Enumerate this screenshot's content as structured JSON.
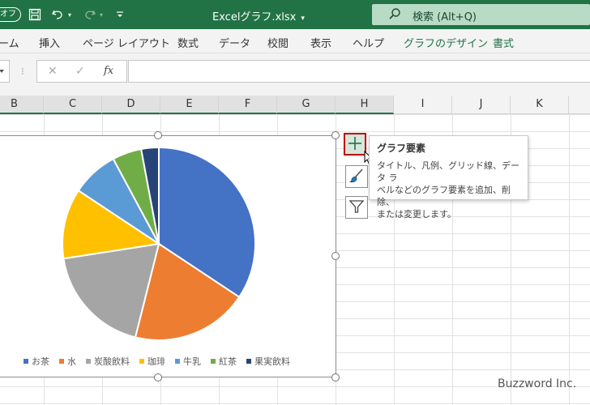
{
  "titlebar": {
    "autosave": "オフ",
    "filename": "Excelグラフ.xlsx",
    "search_label": "検索 (Alt+Q)"
  },
  "ribbon": {
    "tabs": [
      "ーム",
      "挿入",
      "ページ レイアウト",
      "数式",
      "データ",
      "校閲",
      "表示",
      "ヘルプ",
      "グラフのデザイン",
      "書式"
    ]
  },
  "formula_bar": {
    "fx": "fx"
  },
  "columns": [
    "B",
    "C",
    "D",
    "E",
    "F",
    "G",
    "H",
    "I",
    "J",
    "K"
  ],
  "chart_data": {
    "type": "pie",
    "categories": [
      "お茶",
      "水",
      "炭酸飲料",
      "珈琲",
      "牛乳",
      "紅茶",
      "果実飲料"
    ],
    "values": [
      35,
      20,
      19,
      12,
      8,
      5,
      3
    ],
    "colors": [
      "#4472c4",
      "#ed7d31",
      "#a5a5a5",
      "#ffc000",
      "#5b9bd5",
      "#70ad47",
      "#264478"
    ],
    "legend_position": "bottom"
  },
  "chart_buttons": {
    "elements_icon": "plus-icon",
    "styles_icon": "brush-icon",
    "filter_icon": "funnel-icon"
  },
  "tooltip": {
    "title": "グラフ要素",
    "line1": "タイトル、凡例、グリッド線、データ ラ",
    "line2": "ベルなどのグラフ要素を追加、削除、",
    "line3": "または変更します。"
  },
  "watermark": "Buzzword Inc."
}
